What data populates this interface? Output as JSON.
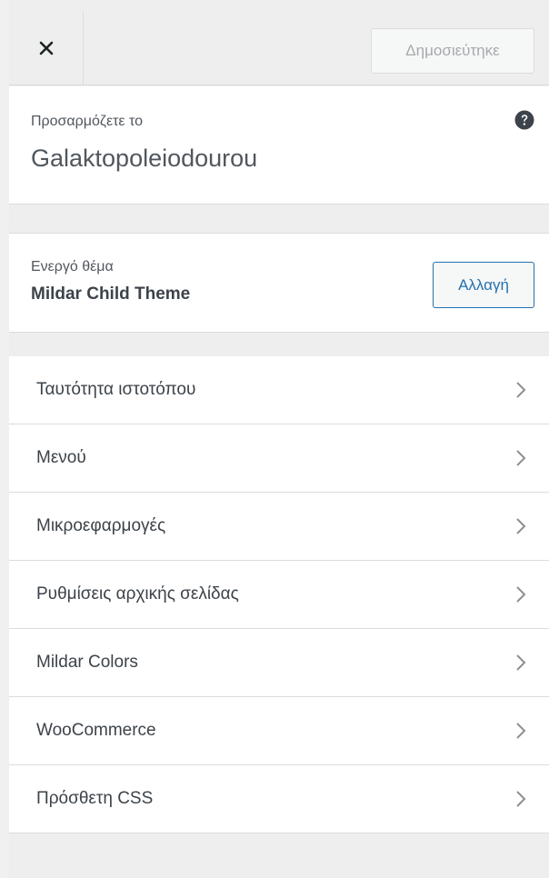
{
  "header": {
    "close_label": "close",
    "publish_label": "Δημοσιεύτηκε"
  },
  "info": {
    "caption": "Προσαρμόζετε το",
    "site_title": "Galaktopoleiodourou",
    "help_icon": "help-icon"
  },
  "theme": {
    "caption": "Ενεργό θέμα",
    "name": "Mildar Child Theme",
    "change_label": "Αλλαγή"
  },
  "panels": [
    {
      "label": "Ταυτότητα ιστοτόπου"
    },
    {
      "label": "Μενού"
    },
    {
      "label": "Μικροεφαρμογές"
    },
    {
      "label": "Ρυθμίσεις αρχικής σελίδας"
    },
    {
      "label": "Mildar Colors"
    },
    {
      "label": "WooCommerce"
    },
    {
      "label": "Πρόσθετη CSS"
    }
  ],
  "colors": {
    "accent": "#2271b1",
    "background": "#eeeeee",
    "panel": "#ffffff"
  }
}
